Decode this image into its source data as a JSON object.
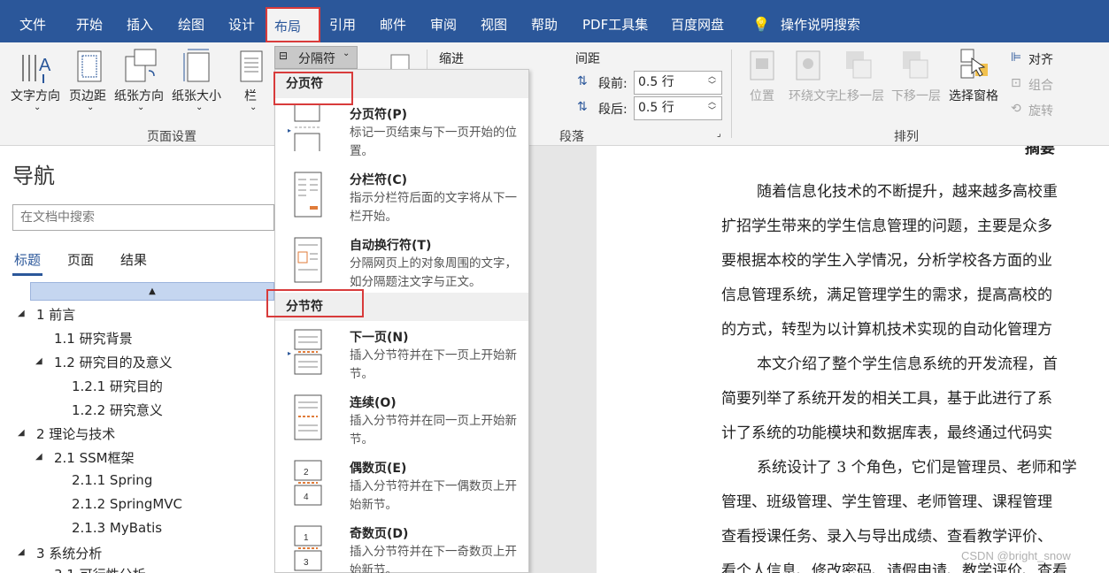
{
  "menubar": {
    "tabs": [
      "文件",
      "开始",
      "插入",
      "绘图",
      "设计",
      "布局",
      "引用",
      "邮件",
      "审阅",
      "视图",
      "帮助",
      "PDF工具集",
      "百度网盘",
      "操作说明搜索"
    ]
  },
  "ribbon": {
    "page_setup": {
      "buttons": [
        "文字方向",
        "页边距",
        "纸张方向",
        "纸张大小",
        "栏"
      ],
      "group_label": "页面设置"
    },
    "breaks_button": "分隔符",
    "paragraph": {
      "indent_label": "缩进",
      "spacing_label": "间距",
      "before_label": "段前:",
      "before_value": "0.5 行",
      "after_label": "段后:",
      "after_value": "0.5 行",
      "group_label": "段落"
    },
    "arrange": {
      "buttons": [
        "位置",
        "环绕文字",
        "上移一层",
        "下移一层",
        "选择窗格"
      ],
      "align": "对齐",
      "group": "组合",
      "rotate": "旋转",
      "group_label": "排列"
    }
  },
  "navigation": {
    "title": "导航",
    "search_placeholder": "在文档中搜索",
    "tabs": [
      "标题",
      "页面",
      "结果"
    ],
    "tree": [
      "1 前言",
      "1.1 研究背景",
      "1.2 研究目的及意义",
      "1.2.1 研究目的",
      "1.2.2 研究意义",
      "2 理论与技术",
      "2.1 SSM框架",
      "2.1.1 Spring",
      "2.1.2 SpringMVC",
      "2.1.3 MyBatis",
      "3 系统分析",
      "3.1 可行性分析"
    ]
  },
  "breaks_menu": {
    "page_breaks_header": "分页符",
    "section_breaks_header": "分节符",
    "items": [
      {
        "title": "分页符(P)",
        "desc": "标记一页结束与下一页开始的位置。"
      },
      {
        "title": "分栏符(C)",
        "desc": "指示分栏符后面的文字将从下一栏开始。"
      },
      {
        "title": "自动换行符(T)",
        "desc": "分隔网页上的对象周围的文字，如分隔题注文字与正文。"
      },
      {
        "title": "下一页(N)",
        "desc": "插入分节符并在下一页上开始新节。"
      },
      {
        "title": "连续(O)",
        "desc": "插入分节符并在同一页上开始新节。"
      },
      {
        "title": "偶数页(E)",
        "desc": "插入分节符并在下一偶数页上开始新节。"
      },
      {
        "title": "奇数页(D)",
        "desc": "插入分节符并在下一奇数页上开始新节。"
      }
    ]
  },
  "document": {
    "heading_fragment": "摘要",
    "lines": [
      "随着信息化技术的不断提升，越来越多高校重",
      "扩招学生带来的学生信息管理的问题，主要是众多",
      "要根据本校的学生入学情况，分析学校各方面的业",
      "信息管理系统，满足管理学生的需求，提高高校的",
      "的方式，转型为以计算机技术实现的自动化管理方",
      "本文介绍了整个学生信息系统的开发流程，首",
      "简要列举了系统开发的相关工具，基于此进行了系",
      "计了系统的功能模块和数据库表，最终通过代码实",
      "系统设计了 3 个角色，它们是管理员、老师和学",
      "管理、班级管理、学生管理、老师管理、课程管理",
      "查看授课任务、录入与导出成绩、查看教学评价、",
      "看个人信息、修改密码、请假申请、教学评价、查看"
    ],
    "watermark": "CSDN @bright_snow"
  },
  "colors": {
    "accent": "#2b579a",
    "highlight": "#d83b3b",
    "selection": "#c5d6f0"
  }
}
